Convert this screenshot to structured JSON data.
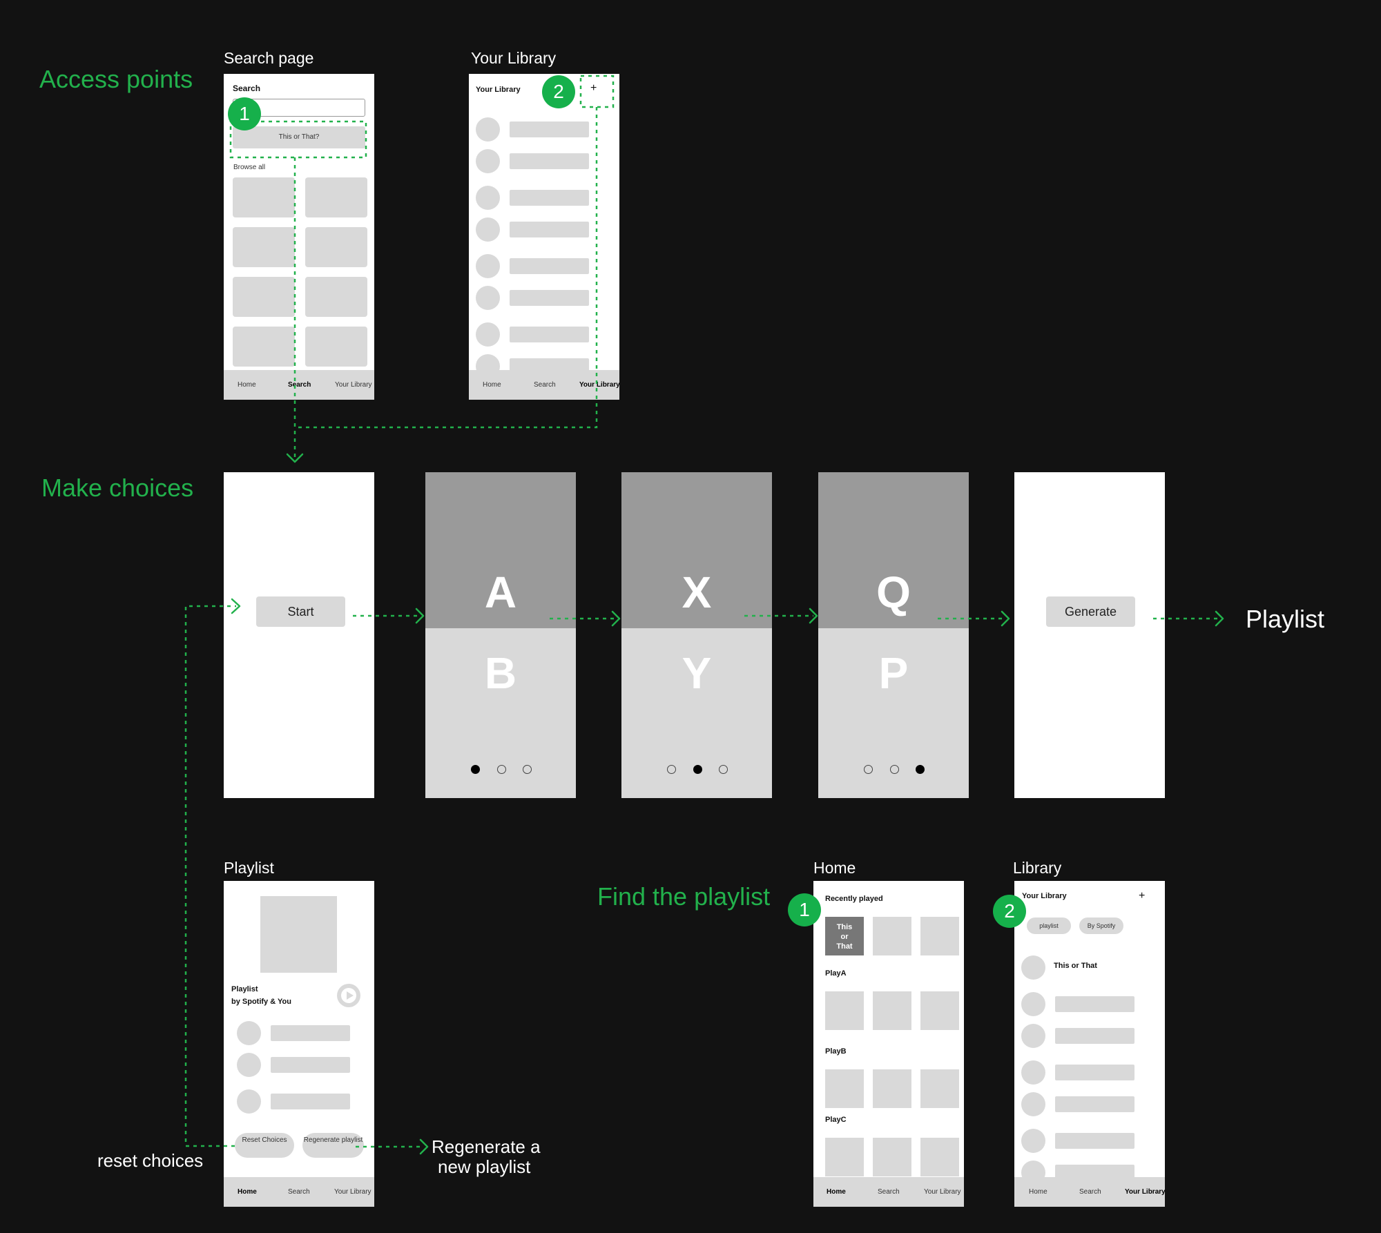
{
  "sections": {
    "access_points": "Access points",
    "make_choices": "Make choices",
    "find_playlist": "Find the playlist"
  },
  "labels": {
    "search_page": "Search page",
    "your_library": "Your Library",
    "playlist": "Playlist",
    "home": "Home",
    "library": "Library"
  },
  "badges": {
    "one": "1",
    "two": "2"
  },
  "search_screen": {
    "title": "Search",
    "this_or_that": "This or That?",
    "browse_all": "Browse all"
  },
  "library_screen": {
    "title": "Your Library",
    "plus": "+"
  },
  "nav": {
    "home": "Home",
    "search": "Search",
    "library": "Your Library"
  },
  "choices": {
    "start": "Start",
    "screen1": {
      "top": "A",
      "bottom": "B"
    },
    "screen2": {
      "top": "X",
      "bottom": "Y"
    },
    "screen3": {
      "top": "Q",
      "bottom": "P"
    },
    "generate": "Generate",
    "result": "Playlist"
  },
  "playlist_screen": {
    "title": "Playlist",
    "subtitle": "by Spotify & You",
    "reset": "Reset Choices",
    "regenerate": "Regenerate playlist"
  },
  "side_notes": {
    "reset_choices": "reset choices",
    "regenerate_line1": "Regenerate a",
    "regenerate_line2": "new playlist"
  },
  "home_screen": {
    "recently_played": "Recently played",
    "tile": "This or That",
    "play_a": "PlayA",
    "play_b": "PlayB",
    "play_c": "PlayC"
  },
  "library2_screen": {
    "title": "Your Library",
    "plus": "+",
    "chip1": "playlist",
    "chip2": "By Spotify",
    "item": "This or That"
  },
  "colors": {
    "accent": "#22b14c",
    "badge": "#16b04b",
    "background": "#121212"
  }
}
